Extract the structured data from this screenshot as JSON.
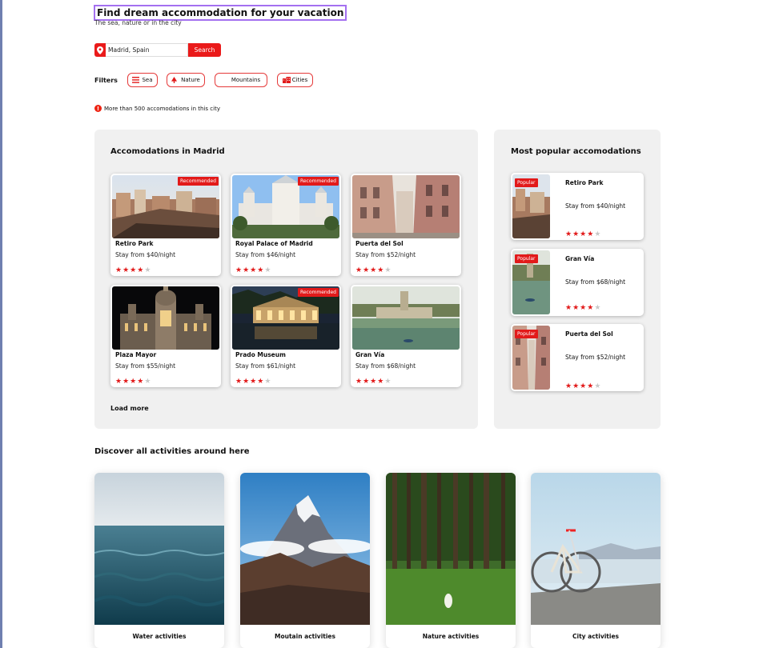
{
  "header": {
    "title": "Find dream accommodation for your vacation",
    "subtitle": "The sea, nature or in the city"
  },
  "search": {
    "value": "Madrid, Spain",
    "button_label": "Search",
    "pin_icon": "map-pin-icon"
  },
  "filters": {
    "label": "Filters",
    "chips": [
      {
        "label": "Sea",
        "icon": "waves-icon"
      },
      {
        "label": "Nature",
        "icon": "tree-icon"
      },
      {
        "label": "Mountains",
        "icon": "mountain-icon"
      },
      {
        "label": "Cities",
        "icon": "city-icon"
      }
    ]
  },
  "info": {
    "text": "More than 500 accomodations in this city",
    "icon": "info-icon"
  },
  "accommodations": {
    "title": "Accomodations in Madrid",
    "items": [
      {
        "name": "Retiro Park",
        "price": "Stay from $40/night",
        "rating": 4,
        "badge": "Recommended"
      },
      {
        "name": "Royal Palace of Madrid",
        "price": "Stay from $46/night",
        "rating": 4,
        "badge": "Recommended"
      },
      {
        "name": "Puerta del Sol",
        "price": "Stay from $52/night",
        "rating": 4,
        "badge": ""
      },
      {
        "name": "Plaza Mayor",
        "price": "Stay from $55/night",
        "rating": 4,
        "badge": ""
      },
      {
        "name": "Prado Museum",
        "price": "Stay from $61/night",
        "rating": 4,
        "badge": "Recommended"
      },
      {
        "name": "Gran Vía",
        "price": "Stay from $68/night",
        "rating": 4,
        "badge": ""
      }
    ],
    "load_more": "Load more"
  },
  "popular": {
    "title": "Most popular accomodations",
    "items": [
      {
        "name": "Retiro Park",
        "price": "Stay from $40/night",
        "rating": 4,
        "badge": "Popular"
      },
      {
        "name": "Gran Vía",
        "price": "Stay from $68/night",
        "rating": 4,
        "badge": "Popular"
      },
      {
        "name": "Puerta del Sol",
        "price": "Stay from $52/night",
        "rating": 4,
        "badge": "Popular"
      }
    ]
  },
  "activities": {
    "title": "Discover all activities around here",
    "items": [
      {
        "label": "Water activities"
      },
      {
        "label": "Moutain activities"
      },
      {
        "label": "Nature activities"
      },
      {
        "label": "City activities"
      }
    ]
  },
  "colors": {
    "accent": "#e21a1a",
    "panel": "#f0f0f0",
    "star_off": "#c8c8c8",
    "focus_outline": "#a470f0"
  }
}
